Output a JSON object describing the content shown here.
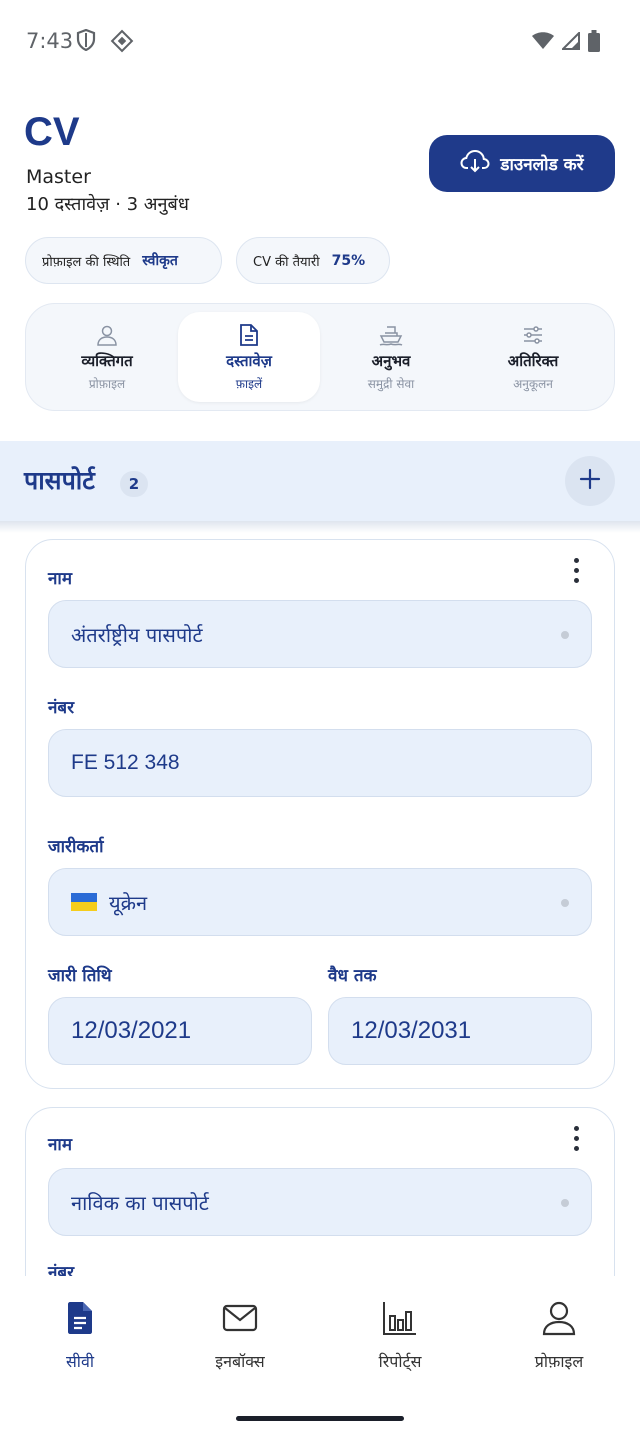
{
  "status_bar": {
    "time": "7:43",
    "icons": [
      "shield-icon",
      "diamond-icon",
      "wifi-icon",
      "signal-icon",
      "battery-icon"
    ]
  },
  "header": {
    "title": "CV",
    "subtitle": "Master",
    "meta": "10 दस्तावेज़ · 3 अनुबंध",
    "download_label": "डाउनलोड करें"
  },
  "chips": {
    "profile_status_label": "प्रोफ़ाइल की स्थिति",
    "profile_status_value": "स्वीकृत",
    "cv_ready_label": "CV की तैयारी",
    "cv_ready_value": "75%"
  },
  "tabs": [
    {
      "label": "व्यक्तिगत",
      "sub": "प्रोफ़ाइल",
      "icon": "person-icon",
      "active": false
    },
    {
      "label": "दस्तावेज़",
      "sub": "फ़ाइलें",
      "icon": "document-icon",
      "active": true
    },
    {
      "label": "अनुभव",
      "sub": "समुद्री सेवा",
      "icon": "ship-icon",
      "active": false
    },
    {
      "label": "अतिरिक्त",
      "sub": "अनुकूलन",
      "icon": "sliders-icon",
      "active": false
    }
  ],
  "section": {
    "title": "पासपोर्ट",
    "count": "2"
  },
  "cards": [
    {
      "name_label": "नाम",
      "name_value": "अंतर्राष्ट्रीय पासपोर्ट",
      "number_label": "नंबर",
      "number_value": "FE 512 348",
      "issuer_label": "जारीकर्ता",
      "issuer_value": "यूक्रेन",
      "issue_date_label": "जारी तिथि",
      "issue_date_value": "12/03/2021",
      "valid_until_label": "वैध तक",
      "valid_until_value": "12/03/2031"
    },
    {
      "name_label": "नाम",
      "name_value": "नाविक का पासपोर्ट",
      "number_label": "नंबर"
    }
  ],
  "bottom_nav": [
    {
      "label": "सीवी",
      "icon": "cv-document-icon",
      "active": true
    },
    {
      "label": "इनबॉक्स",
      "icon": "mail-icon",
      "active": false
    },
    {
      "label": "रिपोर्ट्स",
      "icon": "bar-chart-icon",
      "active": false
    },
    {
      "label": "प्रोफ़ाइल",
      "icon": "user-icon",
      "active": false
    }
  ],
  "colors": {
    "primary": "#1e3a8a",
    "field_bg": "#e8f0fb",
    "section_bg": "#e8f0fb"
  }
}
